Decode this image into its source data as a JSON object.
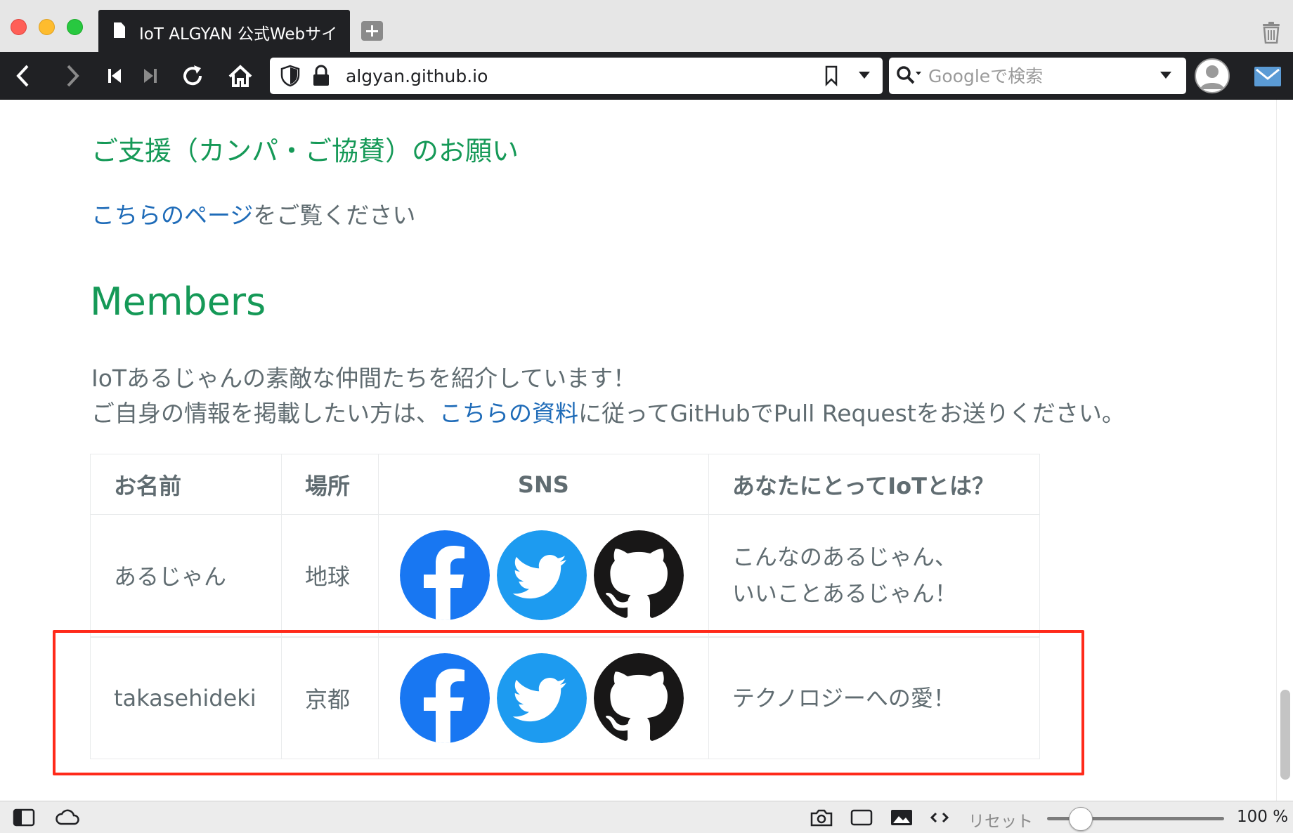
{
  "browser": {
    "tab_title": "IoT ALGYAN 公式Webサイ",
    "url": "algyan.github.io",
    "search_placeholder": "Googleで検索",
    "status": {
      "reset_label": "リセット",
      "zoom_label": "100 %",
      "zoom_percent": 100
    }
  },
  "page": {
    "support": {
      "heading": "ご支援（カンパ・ご協賛）のお願い",
      "link_text": "こちらのページ",
      "text_after": "をご覧ください"
    },
    "members": {
      "heading": "Members",
      "intro_line1": "IoTあるじゃんの素敵な仲間たちを紹介しています！",
      "intro_line2_before": "ご自身の情報を掲載したい方は、",
      "intro_line2_link": "こちらの資料",
      "intro_line2_after": "に従ってGitHubでPull Requestをお送りください。",
      "table": {
        "headers": {
          "name": "お名前",
          "place": "場所",
          "sns": "SNS",
          "iot": "あなたにとってIoTとは？"
        },
        "rows": [
          {
            "name": "あるじゃん",
            "place": "地球",
            "iot_line1": "こんなのあるじゃん、",
            "iot_line2": "いいことあるじゃん！",
            "sns": [
              "facebook-icon",
              "twitter-icon",
              "github-icon"
            ]
          },
          {
            "name": "takasehideki",
            "place": "京都",
            "iot_line1": "テクノロジーへの愛！",
            "iot_line2": "",
            "sns": [
              "facebook-icon",
              "twitter-icon",
              "github-icon"
            ]
          }
        ]
      }
    }
  },
  "colors": {
    "heading_green": "#159957",
    "body_text": "#606c71",
    "link_blue": "#1e6bb8",
    "highlight_red": "#ff2a1a",
    "facebook_blue": "#1877f2",
    "twitter_blue": "#1d9bf0",
    "github_black": "#181717"
  }
}
